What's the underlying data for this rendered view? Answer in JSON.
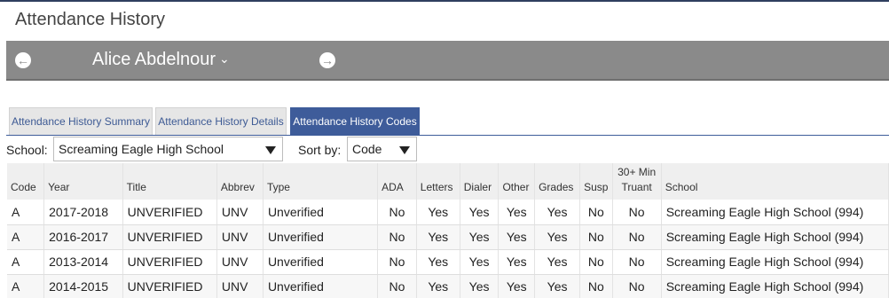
{
  "page": {
    "title": "Attendance History"
  },
  "student": {
    "name": "Alice Abdelnour",
    "prev_icon": "arrow-left-circle-icon",
    "next_icon": "arrow-right-circle-icon"
  },
  "tabs": [
    {
      "label": "Attendance History Summary",
      "active": false
    },
    {
      "label": "Attendance History Details",
      "active": false
    },
    {
      "label": "Attendance History Codes",
      "active": true
    }
  ],
  "filters": {
    "school_label": "School:",
    "school_value": "Screaming Eagle High School",
    "sort_label": "Sort by:",
    "sort_value": "Code"
  },
  "table": {
    "headers": {
      "code": "Code",
      "year": "Year",
      "title": "Title",
      "abbrev": "Abbrev",
      "type": "Type",
      "ada": "ADA",
      "letters": "Letters",
      "dialer": "Dialer",
      "other": "Other",
      "grades": "Grades",
      "susp": "Susp",
      "truant_line1": "30+ Min",
      "truant_line2": "Truant",
      "school": "School"
    },
    "rows": [
      {
        "code": "A",
        "year": "2017-2018",
        "title": "UNVERIFIED",
        "abbrev": "UNV",
        "type": "Unverified",
        "ada": "No",
        "letters": "Yes",
        "dialer": "Yes",
        "other": "Yes",
        "grades": "Yes",
        "susp": "No",
        "truant": "No",
        "school": "Screaming Eagle High School (994)"
      },
      {
        "code": "A",
        "year": "2016-2017",
        "title": "UNVERIFIED",
        "abbrev": "UNV",
        "type": "Unverified",
        "ada": "No",
        "letters": "Yes",
        "dialer": "Yes",
        "other": "Yes",
        "grades": "Yes",
        "susp": "No",
        "truant": "No",
        "school": "Screaming Eagle High School (994)"
      },
      {
        "code": "A",
        "year": "2013-2014",
        "title": "UNVERIFIED",
        "abbrev": "UNV",
        "type": "Unverified",
        "ada": "No",
        "letters": "Yes",
        "dialer": "Yes",
        "other": "Yes",
        "grades": "Yes",
        "susp": "No",
        "truant": "No",
        "school": "Screaming Eagle High School (994)"
      },
      {
        "code": "A",
        "year": "2014-2015",
        "title": "UNVERIFIED",
        "abbrev": "UNV",
        "type": "Unverified",
        "ada": "No",
        "letters": "Yes",
        "dialer": "Yes",
        "other": "Yes",
        "grades": "Yes",
        "susp": "No",
        "truant": "No",
        "school": "Screaming Eagle High School (994)"
      }
    ]
  },
  "colors": {
    "accent": "#3e5c9a",
    "bar": "#8a8a8a"
  }
}
